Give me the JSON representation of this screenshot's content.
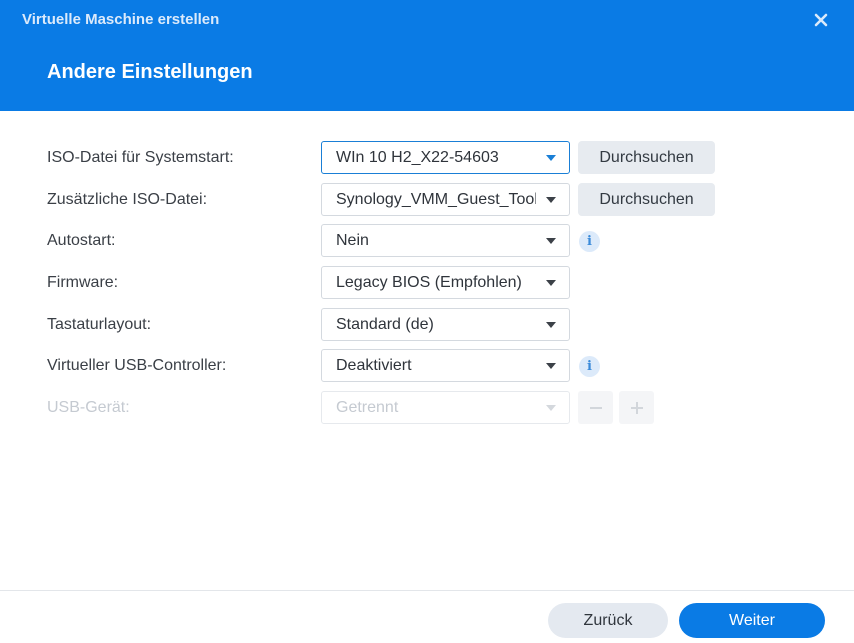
{
  "window": {
    "title": "Virtuelle Maschine erstellen",
    "close_icon": "close-icon",
    "accent_color": "#0a7be5"
  },
  "page": {
    "title": "Andere Einstellungen"
  },
  "fields": {
    "boot_iso": {
      "label": "ISO-Datei für Systemstart:",
      "value": "WIn 10 H2_X22-54603",
      "browse_label": "Durchsuchen"
    },
    "extra_iso": {
      "label": "Zusätzliche ISO-Datei:",
      "value": "Synology_VMM_Guest_Tool",
      "browse_label": "Durchsuchen"
    },
    "autostart": {
      "label": "Autostart:",
      "value": "Nein",
      "info_icon": "info-icon"
    },
    "firmware": {
      "label": "Firmware:",
      "value": "Legacy BIOS (Empfohlen)"
    },
    "keyboard": {
      "label": "Tastaturlayout:",
      "value": "Standard (de)"
    },
    "usb_controller": {
      "label": "Virtueller USB-Controller:",
      "value": "Deaktiviert",
      "info_icon": "info-icon"
    },
    "usb_device": {
      "label": "USB-Gerät:",
      "value": "Getrennt",
      "disabled": true
    }
  },
  "footer": {
    "back_label": "Zurück",
    "next_label": "Weiter"
  }
}
